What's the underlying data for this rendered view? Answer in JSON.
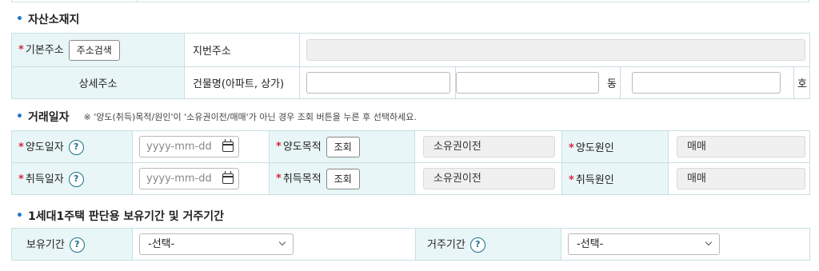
{
  "sections": {
    "asset": {
      "title": "자산소재지"
    },
    "trade": {
      "title": "거래일자",
      "note": "※ '양도(취득)목적/원인'이 '소유권이전/매매'가 아닌 경우 조회 버튼을 누른 후 선택하세요."
    },
    "holding": {
      "title": "1세대1주택 판단용 보유기간 및 거주기간"
    }
  },
  "asset": {
    "base_address_label": "기본주소",
    "address_search_button": "주소검색",
    "lot_address_label": "지번주소",
    "detail_address_label": "상세주소",
    "building_label": "건물명(아파트, 상가)",
    "dong_label": "동",
    "ho_label": "호"
  },
  "trade": {
    "transfer_date_label": "양도일자",
    "acquire_date_label": "취득일자",
    "date_placeholder": "yyyy-mm-dd",
    "transfer_purpose_label": "양도목적",
    "acquire_purpose_label": "취득목적",
    "lookup_button": "조회",
    "transfer_purpose_value": "소유권이전",
    "acquire_purpose_value": "소유권이전",
    "transfer_cause_label": "양도원인",
    "acquire_cause_label": "취득원인",
    "transfer_cause_value": "매매",
    "acquire_cause_value": "매매"
  },
  "holding": {
    "holding_period_label": "보유기간",
    "residence_period_label": "거주기간",
    "select_default": "-선택-"
  },
  "icons": {
    "help": "?",
    "required_mark": "*"
  },
  "colors": {
    "label_bg": "#e9f6f7",
    "border": "#c8dfe2",
    "required": "#d7263d",
    "accent": "#1f78c8"
  }
}
